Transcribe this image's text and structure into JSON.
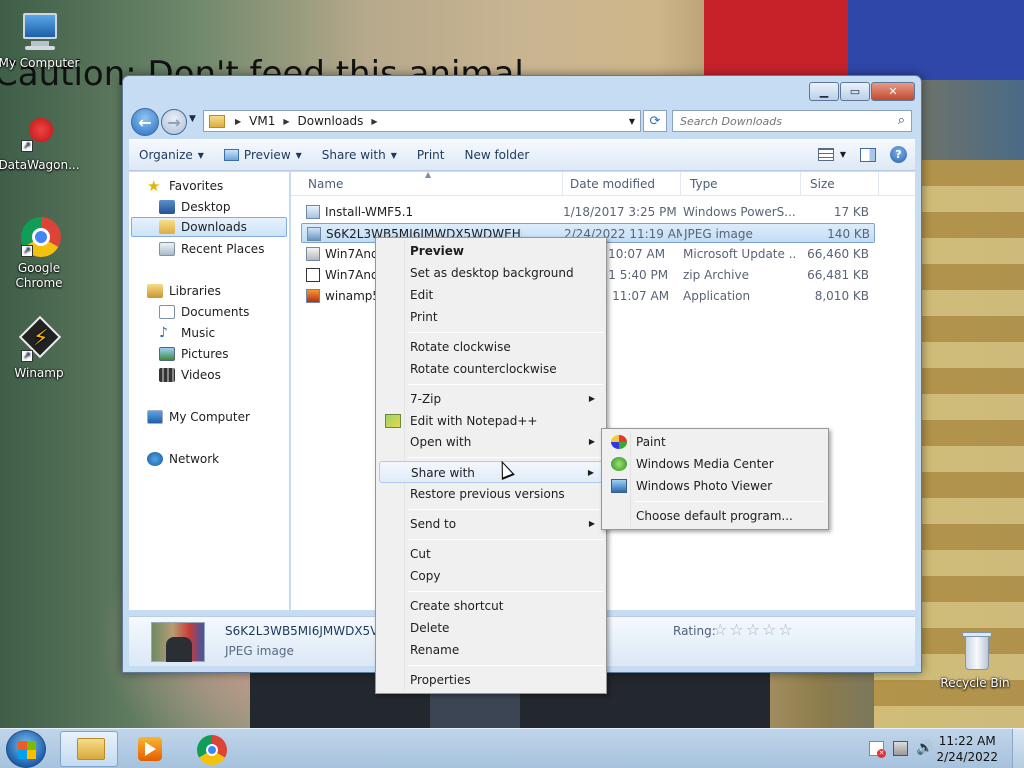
{
  "desktop": {
    "wallpaper_text": "Caution: Don't feed this animal",
    "icons": [
      {
        "label": "My Computer",
        "icon": "computer-icon"
      },
      {
        "label": "DataWagon...",
        "icon": "datawagon-icon"
      },
      {
        "label": "Google Chrome",
        "icon": "chrome-icon"
      },
      {
        "label": "Winamp",
        "icon": "winamp-icon"
      },
      {
        "label": "Recycle Bin",
        "icon": "recycle-bin-icon"
      }
    ]
  },
  "window": {
    "address": {
      "crumbs": [
        "VM1",
        "Downloads"
      ]
    },
    "search": {
      "placeholder": "Search Downloads"
    },
    "toolbar": {
      "organize": "Organize",
      "preview": "Preview",
      "share_with": "Share with",
      "print": "Print",
      "new_folder": "New folder"
    },
    "nav": {
      "favorites": "Favorites",
      "desktop": "Desktop",
      "downloads": "Downloads",
      "recent_places": "Recent Places",
      "libraries": "Libraries",
      "documents": "Documents",
      "music": "Music",
      "pictures": "Pictures",
      "videos": "Videos",
      "my_computer": "My Computer",
      "network": "Network"
    },
    "columns": {
      "name": "Name",
      "date": "Date modified",
      "type": "Type",
      "size": "Size"
    },
    "files": [
      {
        "name": "Install-WMF5.1",
        "date": "1/18/2017 3:25 PM",
        "type": "Windows PowerS...",
        "size": "17 KB"
      },
      {
        "name": "S6K2L3WB5MI6JMWDX5WDWEHJX4",
        "date": "2/24/2022 11:19 AM",
        "type": "JPEG image",
        "size": "140 KB"
      },
      {
        "name": "Win7And",
        "date": "17 10:07 AM",
        "type": "Microsoft Update ...",
        "size": "66,460 KB"
      },
      {
        "name": "Win7And",
        "date": "021 5:40 PM",
        "type": "zip Archive",
        "size": "66,481 KB"
      },
      {
        "name": "winamp5",
        "date": "22 11:07 AM",
        "type": "Application",
        "size": "8,010 KB"
      }
    ],
    "details": {
      "name": "S6K2L3WB5MI6JMWDX5V",
      "type": "JPEG image",
      "rating_label": "Rating:",
      "rating_stars": "☆☆☆☆☆"
    }
  },
  "context_menu": {
    "items": {
      "preview": "Preview",
      "set_bg": "Set as desktop background",
      "edit": "Edit",
      "print": "Print",
      "rotate_cw": "Rotate clockwise",
      "rotate_ccw": "Rotate counterclockwise",
      "zip": "7-Zip",
      "notepad": "Edit with Notepad++",
      "open_with": "Open with",
      "share_with": "Share with",
      "restore": "Restore previous versions",
      "send_to": "Send to",
      "cut": "Cut",
      "copy": "Copy",
      "shortcut": "Create shortcut",
      "delete": "Delete",
      "rename": "Rename",
      "properties": "Properties"
    }
  },
  "open_with_menu": {
    "paint": "Paint",
    "wmc": "Windows Media Center",
    "photo_viewer": "Windows Photo Viewer",
    "choose": "Choose default program..."
  },
  "taskbar": {
    "time": "11:22 AM",
    "date": "2/24/2022"
  },
  "colors": {
    "accent": "#2a6cc1",
    "highlight": "#cde3f8"
  }
}
